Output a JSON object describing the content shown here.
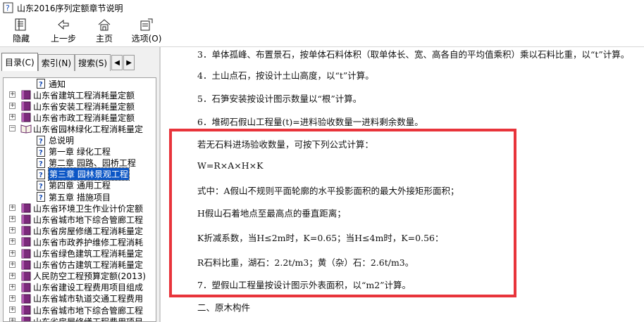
{
  "window": {
    "title": "山东2016序列定额章节说明"
  },
  "toolbar": [
    {
      "label": "隐藏",
      "icon": "hide-panel-icon"
    },
    {
      "label": "上一步",
      "icon": "back-arrow-icon"
    },
    {
      "label": "主页",
      "icon": "home-icon"
    },
    {
      "label": "选项(O)",
      "icon": "options-icon"
    }
  ],
  "tabs": [
    {
      "label": "目录(C)",
      "active": true
    },
    {
      "label": "索引(N)",
      "active": false
    },
    {
      "label": "搜索(S)",
      "active": false
    }
  ],
  "tab_arrows": {
    "left": "◀",
    "right": "▶"
  },
  "tree": [
    {
      "label": "通知",
      "type": "doc",
      "level": 1,
      "expander": ""
    },
    {
      "label": "山东省建筑工程消耗量定额",
      "type": "book",
      "level": 0,
      "expander": "+"
    },
    {
      "label": "山东省安装工程消耗量定额",
      "type": "book",
      "level": 0,
      "expander": "+"
    },
    {
      "label": "山东省市政工程消耗量定额",
      "type": "book",
      "level": 0,
      "expander": "+"
    },
    {
      "label": "山东省园林绿化工程消耗量定",
      "type": "openbook",
      "level": 0,
      "expander": "−"
    },
    {
      "label": "总说明",
      "type": "doc",
      "level": 1,
      "expander": ""
    },
    {
      "label": "第一章  绿化工程",
      "type": "doc",
      "level": 1,
      "expander": ""
    },
    {
      "label": "第二章  园路、园桥工程",
      "type": "doc",
      "level": 1,
      "expander": ""
    },
    {
      "label": "第三章  园林景观工程",
      "type": "doc",
      "level": 1,
      "expander": "",
      "selected": true
    },
    {
      "label": "第四章  通用工程",
      "type": "doc",
      "level": 1,
      "expander": ""
    },
    {
      "label": "第五章  措施项目",
      "type": "doc",
      "level": 1,
      "expander": ""
    },
    {
      "label": "山东省环境卫生作业计价定额",
      "type": "book",
      "level": 0,
      "expander": "+"
    },
    {
      "label": "山东省城市地下综合管廊工程",
      "type": "book",
      "level": 0,
      "expander": "+"
    },
    {
      "label": "山东省房屋修缮工程消耗量定",
      "type": "book",
      "level": 0,
      "expander": "+"
    },
    {
      "label": "山东省市政养护维修工程消耗",
      "type": "book",
      "level": 0,
      "expander": "+"
    },
    {
      "label": "山东省绿色建筑工程消耗量定",
      "type": "book",
      "level": 0,
      "expander": "+"
    },
    {
      "label": "山东省仿古建筑工程消耗量定",
      "type": "book",
      "level": 0,
      "expander": "+"
    },
    {
      "label": "人民防空工程预算定额(2013)",
      "type": "book",
      "level": 0,
      "expander": "+"
    },
    {
      "label": "山东省建设工程费用项目组成",
      "type": "book",
      "level": 0,
      "expander": "+"
    },
    {
      "label": "山东省城市轨道交通工程费用",
      "type": "book",
      "level": 0,
      "expander": "+"
    },
    {
      "label": "山东省城市地下综合管廊工程",
      "type": "book",
      "level": 0,
      "expander": "+"
    },
    {
      "label": "山东省房屋修缮工程费用项目",
      "type": "book",
      "level": 0,
      "expander": "+"
    }
  ],
  "content": {
    "lines": [
      "3．单体孤峰、布置景石，按单体石料体积（取单体长、宽、高各自的平均值乘积）乘以石料比重，以“t”计算。",
      "4．土山点石，按设计土山高度，以“t”计算。",
      "5．石笋安装按设计图示数量以“根”计算。",
      "6．堆砌石假山工程量(t)=进料验收数量一进料剩余数量。",
      "若无石料进场验收数量，可按下列公式计算：",
      "W=R×A×H×K",
      "式中：A假山不规则平面轮廓的水平投影面积的最大外接矩形面积；",
      "H假山石着地点至最高点的垂直距离；",
      "K折减系数，当H≤2m时，K=0.65；当H≤4m时，K=0.56：",
      "R石料比重，湖石：2.2t/m3；黄（杂）石：2.6t/m3。",
      "7．塑假山工程量按设计图示外表面积，以“m2”计算。",
      "二、原木构件"
    ]
  },
  "colors": {
    "highlight": "#e8343b",
    "selection": "#0b56c6"
  }
}
